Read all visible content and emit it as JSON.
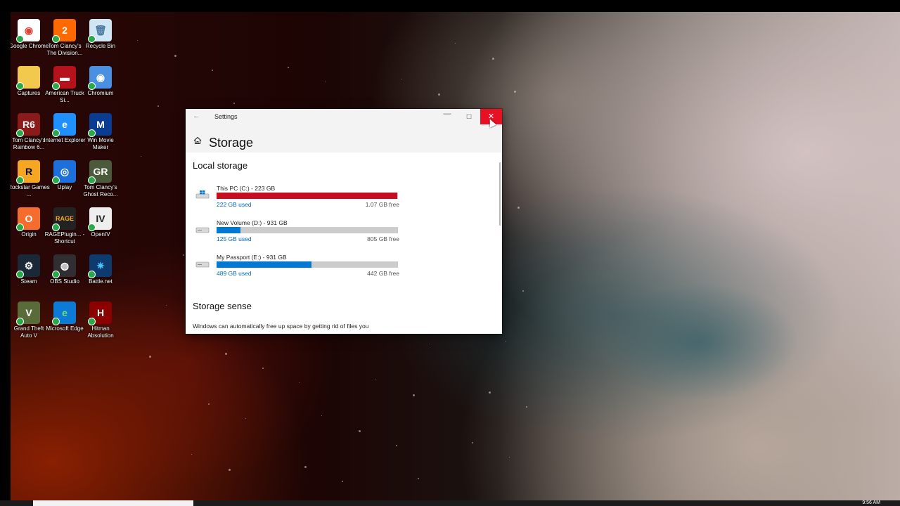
{
  "desktop": {
    "icons": [
      {
        "label": "Google Chrome",
        "icon": "chrome-icon",
        "bg": "#ffffff",
        "glyph": "◉",
        "fg": "#db4437"
      },
      {
        "label": "Tom Clancy's The Division...",
        "icon": "division-2-icon",
        "bg": "#ff6a00",
        "glyph": "2",
        "fg": "#ffffff"
      },
      {
        "label": "Recycle Bin",
        "icon": "recycle-bin-icon",
        "bg": "#cfe6f5",
        "glyph": "🗑",
        "fg": "#4a7aa0"
      },
      {
        "label": "Captures",
        "icon": "folder-icon",
        "bg": "#f2c94c",
        "glyph": "",
        "fg": "#ffffff"
      },
      {
        "label": "American Truck Si...",
        "icon": "american-truck-icon",
        "bg": "#b5121b",
        "glyph": "▬",
        "fg": "#ffffff"
      },
      {
        "label": "Chromium",
        "icon": "chromium-icon",
        "bg": "#4a90e2",
        "glyph": "◉",
        "fg": "#ffffff"
      },
      {
        "label": "Tom Clancy's Rainbow 6...",
        "icon": "rainbow-six-icon",
        "bg": "#8b1a1a",
        "glyph": "R6",
        "fg": "#ffffff"
      },
      {
        "label": "Internet Explorer",
        "icon": "internet-explorer-icon",
        "bg": "#1e90ff",
        "glyph": "e",
        "fg": "#ffffff"
      },
      {
        "label": "Win Movie Maker",
        "icon": "movie-maker-icon",
        "bg": "#0a3d91",
        "glyph": "M",
        "fg": "#ffffff"
      },
      {
        "label": "Rockstar Games ...",
        "icon": "rockstar-icon",
        "bg": "#f5a623",
        "glyph": "R",
        "fg": "#000000"
      },
      {
        "label": "Uplay",
        "icon": "uplay-icon",
        "bg": "#1d6fdb",
        "glyph": "◎",
        "fg": "#ffffff"
      },
      {
        "label": "Tom Clancy's Ghost Reco...",
        "icon": "ghost-recon-icon",
        "bg": "#4a5a3a",
        "glyph": "GR",
        "fg": "#ffffff"
      },
      {
        "label": "Origin",
        "icon": "origin-icon",
        "bg": "#f56c2d",
        "glyph": "O",
        "fg": "#ffffff"
      },
      {
        "label": "RAGEPlugin... - Shortcut",
        "icon": "rage-plugin-icon",
        "bg": "#222222",
        "glyph": "RAGE",
        "fg": "#f5a623"
      },
      {
        "label": "OpenIV",
        "icon": "openiv-icon",
        "bg": "#eeeeee",
        "glyph": "IV",
        "fg": "#222222"
      },
      {
        "label": "Steam",
        "icon": "steam-icon",
        "bg": "#1b2838",
        "glyph": "⚙",
        "fg": "#ffffff"
      },
      {
        "label": "OBS Studio",
        "icon": "obs-icon",
        "bg": "#302e31",
        "glyph": "◍",
        "fg": "#ffffff"
      },
      {
        "label": "Battle.net",
        "icon": "battlenet-icon",
        "bg": "#0e3b6f",
        "glyph": "✷",
        "fg": "#4fc3f7"
      },
      {
        "label": "Grand Theft Auto V",
        "icon": "gta-v-icon",
        "bg": "#5a6b3a",
        "glyph": "V",
        "fg": "#ffffff"
      },
      {
        "label": "Microsoft Edge",
        "icon": "edge-icon",
        "bg": "#0c7bd6",
        "glyph": "e",
        "fg": "#6fe07a"
      },
      {
        "label": "Hitman Absolution",
        "icon": "hitman-icon",
        "bg": "#8b0000",
        "glyph": "H",
        "fg": "#ffffff"
      }
    ]
  },
  "window": {
    "title": "Settings",
    "back_glyph": "←",
    "minimize_glyph": "—",
    "maximize_glyph": "☐",
    "close_glyph": "✕",
    "page_title": "Storage",
    "local_storage_title": "Local storage",
    "drives": [
      {
        "name": "This PC (C:) - 223 GB",
        "used": "222 GB used",
        "free": "1.07 GB free",
        "fraction": 0.995,
        "color": "#c50f1f",
        "icon": "windows-drive-icon"
      },
      {
        "name": "New Volume (D:) - 931 GB",
        "used": "125 GB used",
        "free": "805 GB free",
        "fraction": 0.13,
        "color": "#0078d4",
        "icon": "drive-icon"
      },
      {
        "name": "My Passport (E:) - 931 GB",
        "used": "489 GB used",
        "free": "442 GB free",
        "fraction": 0.525,
        "color": "#0078d4",
        "icon": "drive-icon"
      }
    ],
    "storage_sense_title": "Storage sense",
    "storage_sense_text": "Windows can automatically free up space by getting rid of files you"
  },
  "taskbar": {
    "clock": "9:56 AM"
  }
}
